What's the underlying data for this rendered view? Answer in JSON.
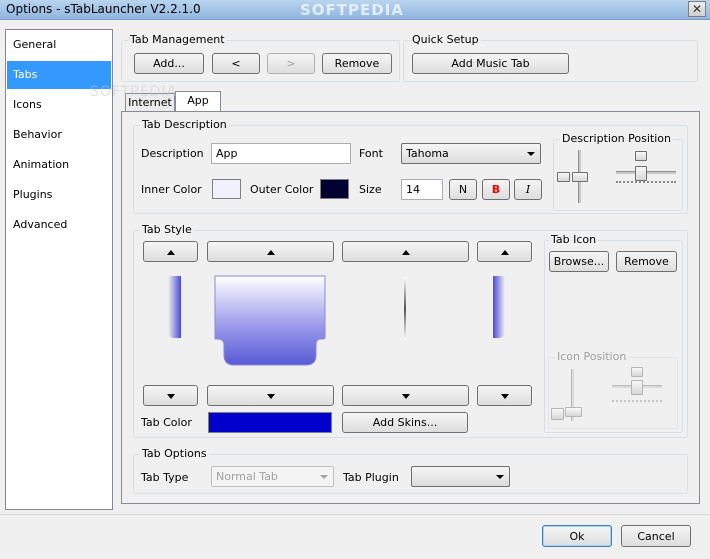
{
  "window": {
    "title": "Options - sTabLauncher V2.2.1.0",
    "close_glyph": "✕",
    "watermark": "SOFTPEDIA"
  },
  "sidebar": {
    "items": [
      "General",
      "Tabs",
      "Icons",
      "Behavior",
      "Animation",
      "Plugins",
      "Advanced"
    ],
    "selected": "Tabs"
  },
  "tab_management": {
    "title": "Tab Management",
    "add": "Add...",
    "left": "<",
    "right": ">",
    "remove": "Remove"
  },
  "quick_setup": {
    "title": "Quick Setup",
    "add_music": "Add Music Tab"
  },
  "tabs": {
    "items": [
      "Internet",
      "App"
    ],
    "selected": "App"
  },
  "tab_description": {
    "title": "Tab Description",
    "description_label": "Description",
    "description_value": "App",
    "font_label": "Font",
    "font_value": "Tahoma",
    "inner_color_label": "Inner Color",
    "inner_color": "#f0f0ff",
    "outer_color_label": "Outer Color",
    "outer_color": "#000033",
    "size_label": "Size",
    "size_value": "14",
    "normal": "N",
    "bold": "B",
    "italic": "I",
    "bold_color": "#ff0000"
  },
  "description_position": {
    "title": "Description Position"
  },
  "tab_style": {
    "title": "Tab Style",
    "tab_color_label": "Tab Color",
    "tab_color": "#0000cc",
    "add_skins": "Add Skins..."
  },
  "tab_icon": {
    "title": "Tab Icon",
    "browse": "Browse...",
    "remove": "Remove"
  },
  "icon_position": {
    "title": "Icon Position"
  },
  "tab_options": {
    "title": "Tab Options",
    "tab_type_label": "Tab Type",
    "tab_type_value": "Normal Tab",
    "tab_plugin_label": "Tab Plugin",
    "tab_plugin_value": ""
  },
  "footer": {
    "ok": "Ok",
    "cancel": "Cancel"
  }
}
